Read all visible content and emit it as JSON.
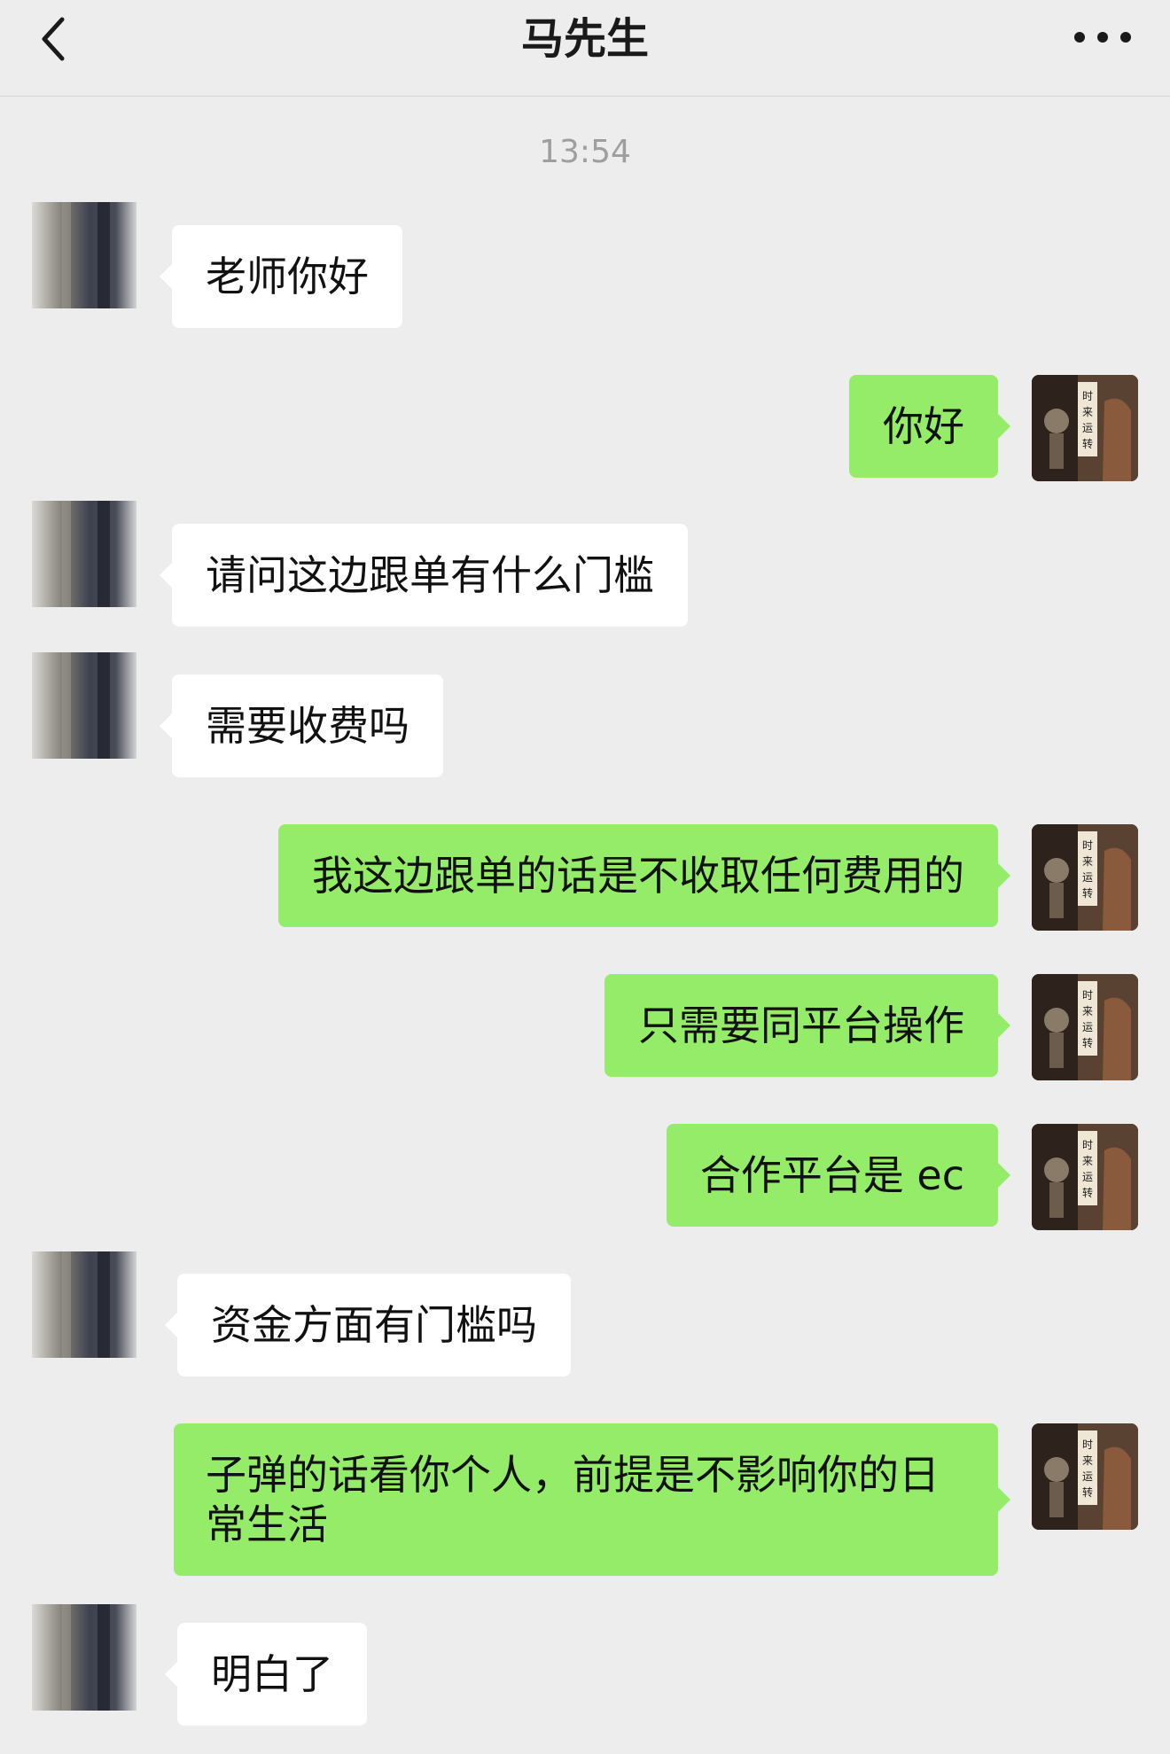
{
  "nav": {
    "title": "马先生",
    "back_icon": "chevron-left-icon",
    "more_icon": "more-dots-icon"
  },
  "timestamp": "13:54",
  "colors": {
    "background": "#ededed",
    "self_bubble": "#95ec69",
    "peer_bubble": "#ffffff"
  },
  "self_avatar_text": "时来运转",
  "messages": [
    {
      "from": "peer",
      "text": "老师你好"
    },
    {
      "from": "self",
      "text": "你好"
    },
    {
      "from": "peer",
      "text": "请问这边跟单有什么门槛"
    },
    {
      "from": "peer",
      "text": "需要收费吗"
    },
    {
      "from": "self",
      "text": "我这边跟单的话是不收取任何费用的"
    },
    {
      "from": "self",
      "text": "只需要同平台操作"
    },
    {
      "from": "self",
      "text": "合作平台是 ec"
    },
    {
      "from": "peer",
      "text": "资金方面有门槛吗"
    },
    {
      "from": "self",
      "text": "子弹的话看你个人，前提是不影响你的日常生活"
    },
    {
      "from": "peer",
      "text": "明白了"
    }
  ]
}
